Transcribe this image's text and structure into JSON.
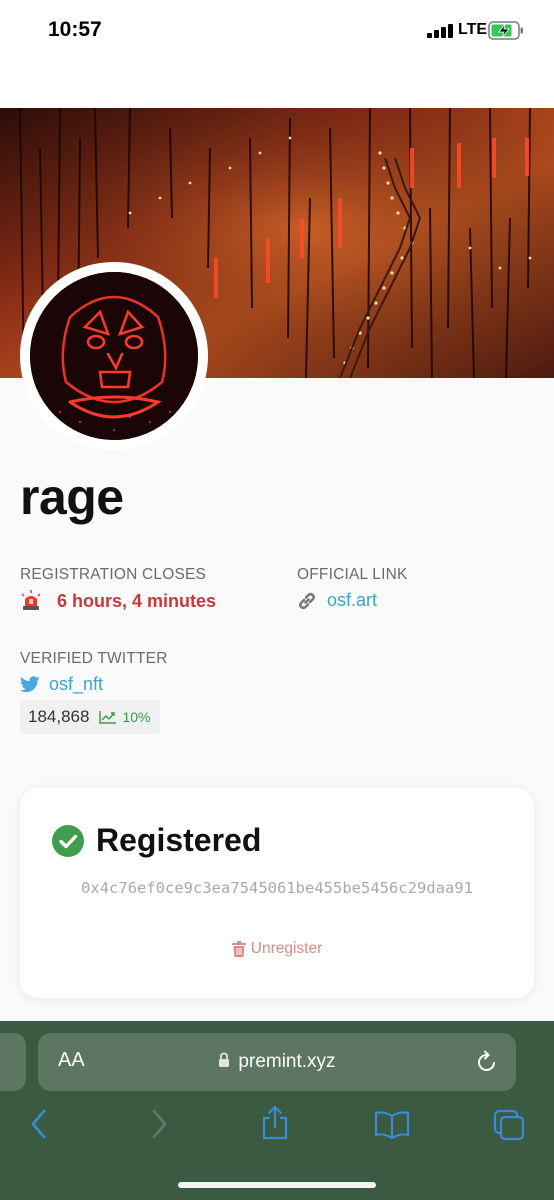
{
  "status_bar": {
    "time": "10:57",
    "network": "LTE"
  },
  "project": {
    "name": "rage"
  },
  "registration": {
    "label": "REGISTRATION CLOSES",
    "countdown": "6 hours, 4 minutes",
    "countdown_color": "#c83a3a"
  },
  "official_link": {
    "label": "OFFICIAL LINK",
    "value": "osf.art"
  },
  "twitter": {
    "label": "VERIFIED TWITTER",
    "handle": "osf_nft",
    "followers": "184,868",
    "growth": "10%"
  },
  "status_card": {
    "title": "Registered",
    "wallet": "0x4c76ef0ce9c3ea7545061be455be5456c29daa91",
    "unregister_label": "Unregister"
  },
  "browser": {
    "aa_label": "AA",
    "url": "premint.xyz"
  },
  "colors": {
    "accent_link": "#3aa7c7",
    "success": "#3a9a4a",
    "danger": "#c83a3a",
    "toolbar": "#3a5a42"
  }
}
